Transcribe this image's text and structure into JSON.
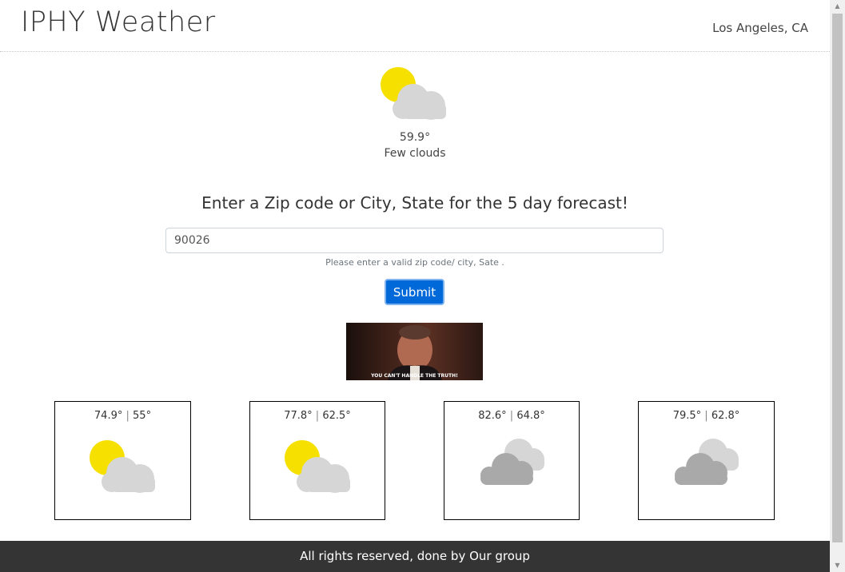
{
  "header": {
    "brand": "IPHY Weather",
    "location": "Los Angeles, CA"
  },
  "current": {
    "icon": "few-clouds-icon",
    "temp": "59.9°",
    "description": "Few clouds"
  },
  "search": {
    "prompt": "Enter a Zip code or City, State for the 5 day forecast!",
    "value": "90026",
    "help": "Please enter a valid zip code/ city, Sate .",
    "submit_label": "Submit"
  },
  "gif": {
    "caption": "YOU CAN'T HANDLE THE TRUTH!"
  },
  "forecast": [
    {
      "high": "74.9°",
      "sep": "|",
      "low": "55°",
      "icon": "few-clouds-icon"
    },
    {
      "high": "77.8°",
      "sep": "|",
      "low": "62.5°",
      "icon": "few-clouds-icon"
    },
    {
      "high": "82.6°",
      "sep": "|",
      "low": "64.8°",
      "icon": "broken-clouds-icon"
    },
    {
      "high": "79.5°",
      "sep": "|",
      "low": "62.8°",
      "icon": "broken-clouds-icon"
    }
  ],
  "footer": {
    "text": "All rights reserved, done by Our group"
  },
  "colors": {
    "sun": "#f5e000",
    "cloud_light": "#d6d6d6",
    "cloud_dark": "#a9a9a9",
    "button": "#0069d9",
    "footer": "#343434"
  }
}
